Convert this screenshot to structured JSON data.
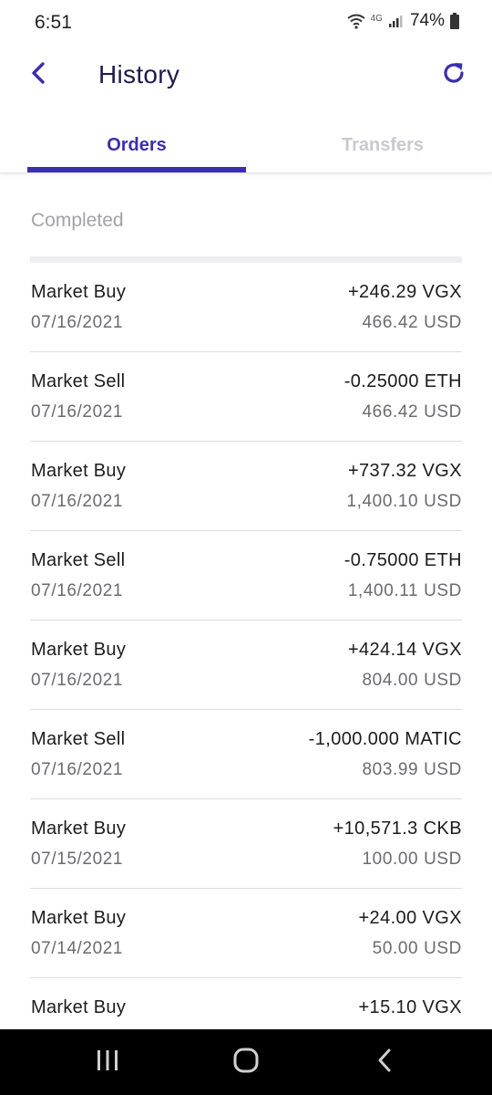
{
  "status_bar": {
    "time": "6:51",
    "network": "4G",
    "battery": "74%"
  },
  "header": {
    "title": "History",
    "back_icon": "chevron-left-icon",
    "refresh_icon": "refresh-icon",
    "accent_color": "#3a2fae"
  },
  "tabs": [
    {
      "label": "Orders",
      "active": true
    },
    {
      "label": "Transfers",
      "active": false
    }
  ],
  "section": {
    "title": "Completed"
  },
  "orders": [
    {
      "type": "Market Buy",
      "date": "07/16/2021",
      "amount": "+246.29 VGX",
      "usd": "466.42 USD"
    },
    {
      "type": "Market Sell",
      "date": "07/16/2021",
      "amount": "-0.25000 ETH",
      "usd": "466.42 USD"
    },
    {
      "type": "Market Buy",
      "date": "07/16/2021",
      "amount": "+737.32 VGX",
      "usd": "1,400.10 USD"
    },
    {
      "type": "Market Sell",
      "date": "07/16/2021",
      "amount": "-0.75000 ETH",
      "usd": "1,400.11 USD"
    },
    {
      "type": "Market Buy",
      "date": "07/16/2021",
      "amount": "+424.14 VGX",
      "usd": "804.00 USD"
    },
    {
      "type": "Market Sell",
      "date": "07/16/2021",
      "amount": "-1,000.000 MATIC",
      "usd": "803.99 USD"
    },
    {
      "type": "Market Buy",
      "date": "07/15/2021",
      "amount": "+10,571.3 CKB",
      "usd": "100.00 USD"
    },
    {
      "type": "Market Buy",
      "date": "07/14/2021",
      "amount": "+24.00 VGX",
      "usd": "50.00 USD"
    },
    {
      "type": "Market Buy",
      "date": "",
      "amount": "+15.10 VGX",
      "usd": ""
    }
  ],
  "nav_bar": {
    "recents_icon": "recents-icon",
    "home_icon": "home-icon",
    "back_icon": "back-icon"
  }
}
